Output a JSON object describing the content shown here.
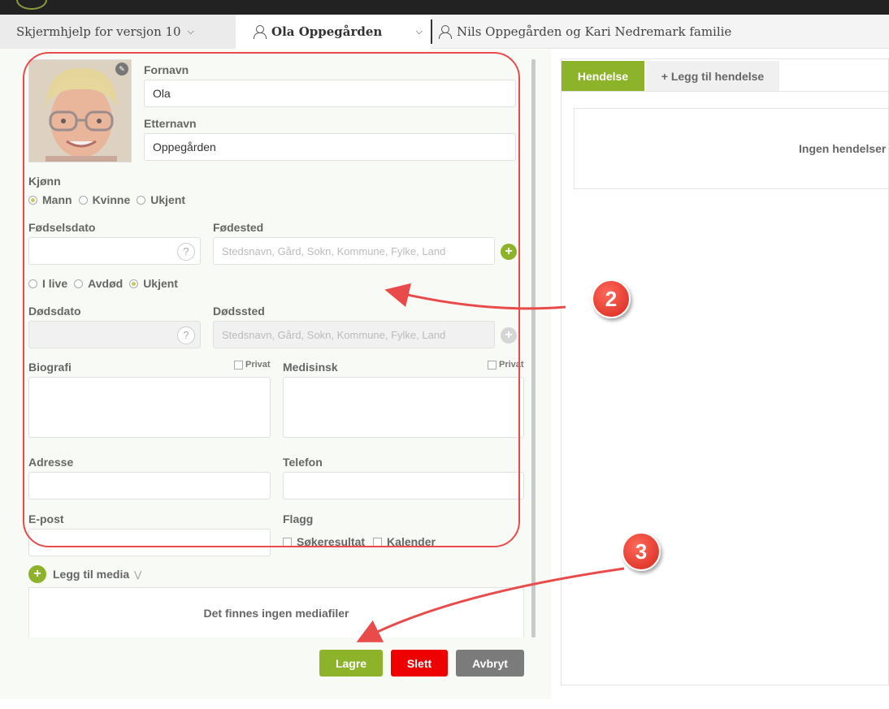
{
  "nav": {
    "help_label": "Skjermhjelp for versjon 10",
    "person_name": "Ola Oppegården",
    "family_label": "Nils Oppegården og Kari Nedremark familie"
  },
  "form": {
    "first_name_label": "Fornavn",
    "first_name_value": "Ola",
    "last_name_label": "Etternavn",
    "last_name_value": "Oppegården",
    "gender_label": "Kjønn",
    "gender_options": [
      "Mann",
      "Kvinne",
      "Ukjent"
    ],
    "gender_selected": "Mann",
    "birth_date_label": "Fødselsdato",
    "birth_place_label": "Fødested",
    "place_placeholder": "Stedsnavn, Gård, Sokn, Kommune, Fylke, Land",
    "alive_options": [
      "I live",
      "Avdød",
      "Ukjent"
    ],
    "alive_selected": "Ukjent",
    "death_date_label": "Dødsdato",
    "death_place_label": "Dødssted",
    "biography_label": "Biografi",
    "medical_label": "Medisinsk",
    "private_label": "Privat",
    "address_label": "Adresse",
    "phone_label": "Telefon",
    "email_label": "E-post",
    "flags_label": "Flagg",
    "flag_search": "Søkeresultat",
    "flag_calendar": "Kalender",
    "help_symbol": "?"
  },
  "media": {
    "add_label": "Legg til media",
    "empty_text": "Det finnes ingen mediafiler"
  },
  "actions": {
    "save": "Lagre",
    "delete": "Slett",
    "cancel": "Avbryt"
  },
  "events": {
    "tab_active": "Hendelse",
    "tab_add": "+ Legg til hendelse",
    "empty_text": "Ingen hendelser t"
  },
  "annotations": {
    "badge_2": "2",
    "badge_3": "3"
  },
  "colors": {
    "accent_green": "#8db32a",
    "delete_red": "#ee0000",
    "cancel_grey": "#7b7b7b",
    "annotation_red": "#e94b4b"
  }
}
